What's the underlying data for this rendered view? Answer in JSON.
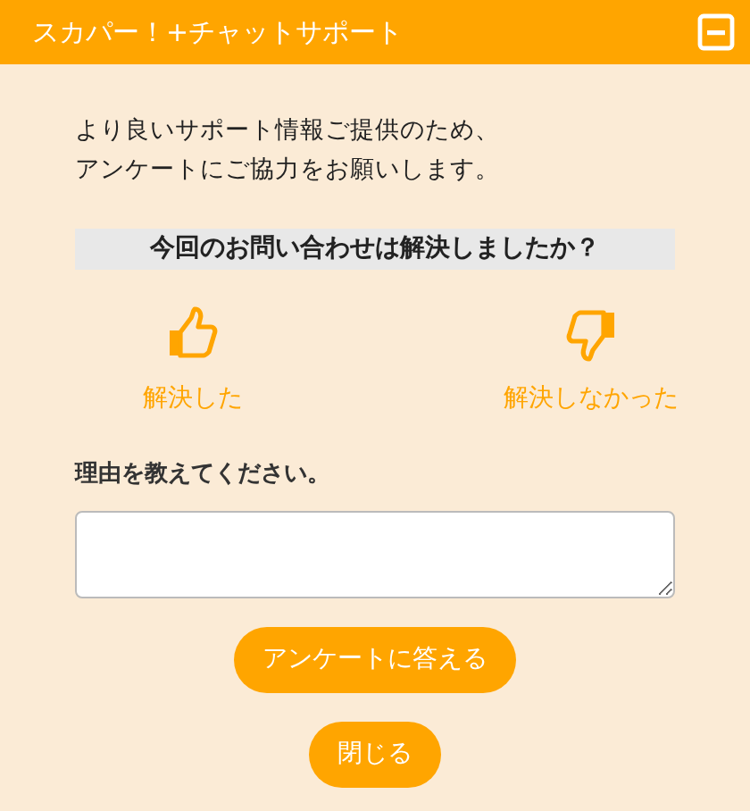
{
  "window": {
    "title": "スカパー！+チャットサポート"
  },
  "intro": [
    "より良いサポート情報ご提供のため、",
    "アンケートにご協力をお願いします。"
  ],
  "question": "今回のお問い合わせは解決しましたか？",
  "options": [
    {
      "kind": "up",
      "label": "解決した"
    },
    {
      "kind": "down",
      "label": "解決しなかった"
    }
  ],
  "reason": {
    "label": "理由を教えてください。"
  },
  "buttons": [
    "アンケートに答える",
    "閉じる"
  ]
}
